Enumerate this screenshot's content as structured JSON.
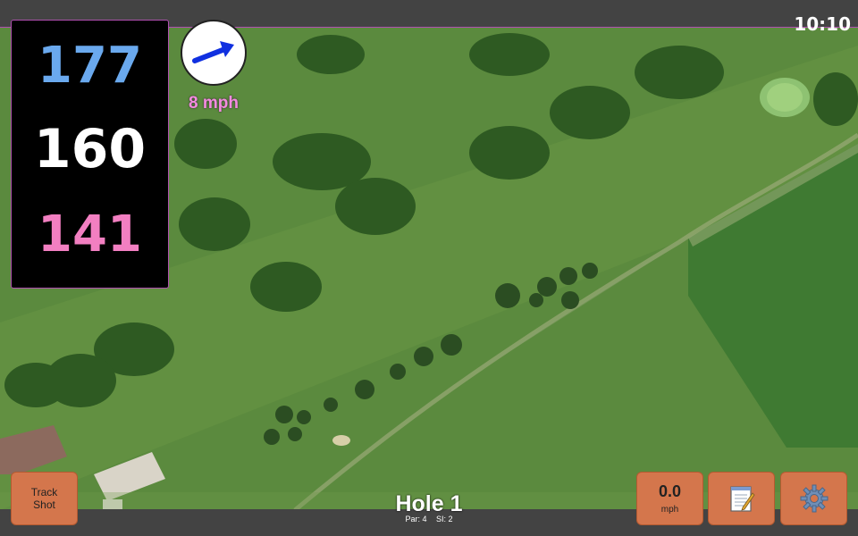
{
  "status": {
    "time": "10:10"
  },
  "yardage": {
    "back": "177",
    "middle": "160",
    "front": "141"
  },
  "wind": {
    "speed_label": "8 mph",
    "arrow_icon": "wind-direction-arrow-icon"
  },
  "controls": {
    "track_shot_line1": "Track",
    "track_shot_line2": "Shot",
    "speed_value": "0.0",
    "speed_unit": "mph",
    "notes_icon": "notepad-icon",
    "settings_icon": "gear-icon"
  },
  "hole": {
    "title": "Hole 1",
    "par": "Par: 4",
    "si": "SI: 2"
  },
  "colors": {
    "accent": "#d4764c",
    "back_yardage": "#6aa9ee",
    "front_yardage": "#f27fc1",
    "wind_text": "#f48be0",
    "border": "#b04fb0"
  }
}
